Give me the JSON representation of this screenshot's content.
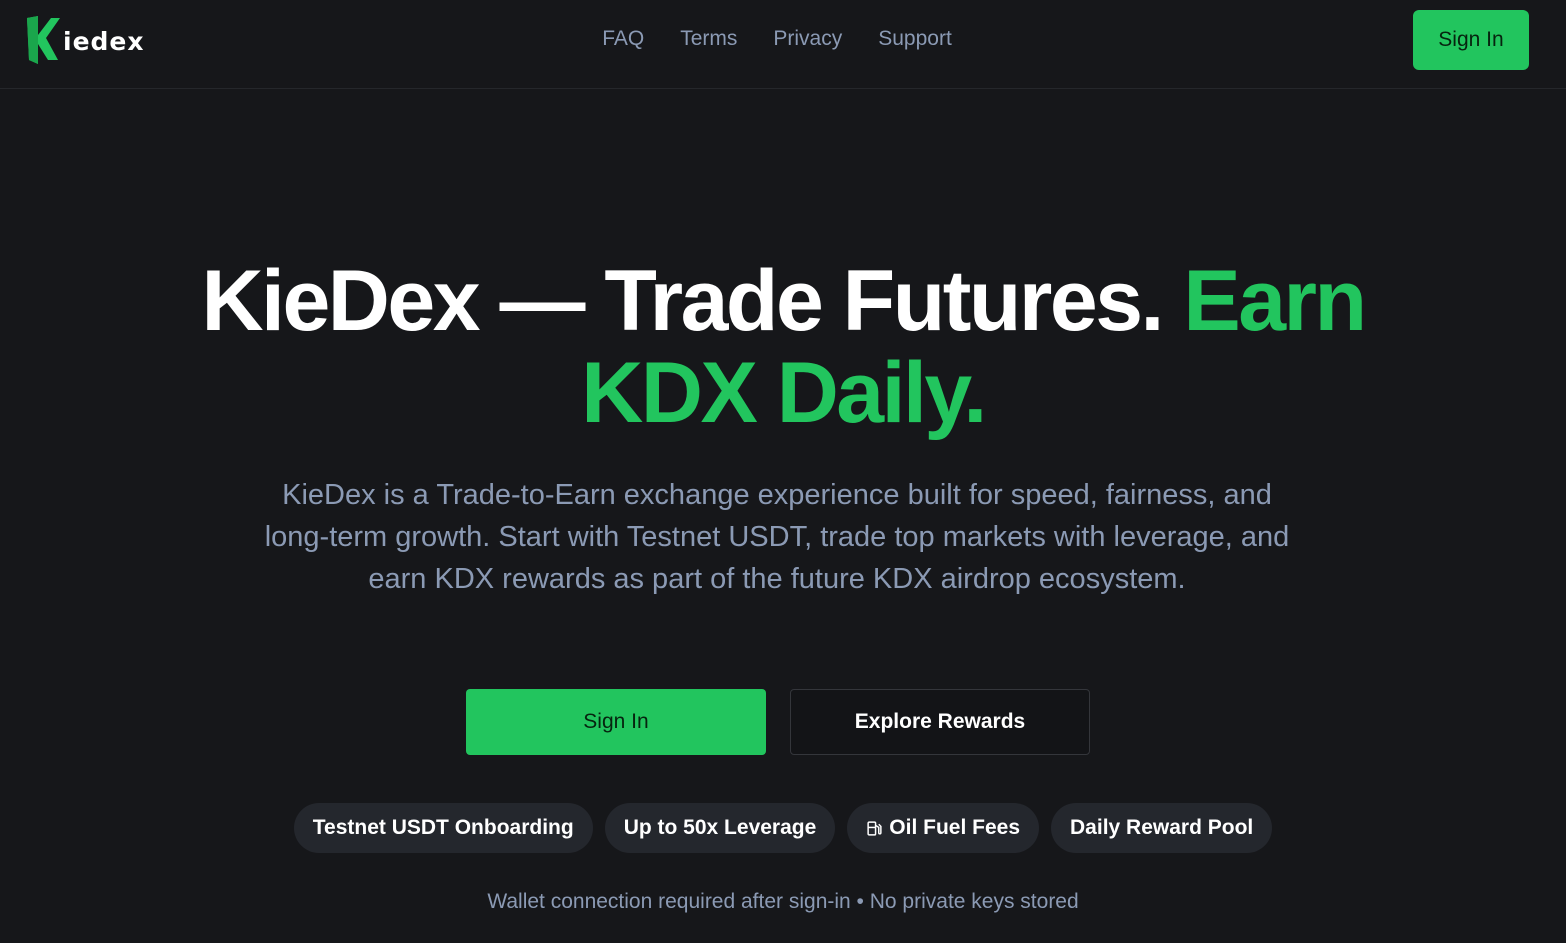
{
  "brand": {
    "logo_text": "iedex",
    "logo_icon": "kiedex-k-logo-icon"
  },
  "nav": {
    "links": [
      "FAQ",
      "Terms",
      "Privacy",
      "Support"
    ],
    "sign_in_label": "Sign In"
  },
  "hero": {
    "title_white": "KieDex — Trade Futures. ",
    "title_green_1": "Earn",
    "title_green_2": "KDX Daily.",
    "description": "KieDex is a Trade-to-Earn exchange experience built for speed, fairness, and long-term growth. Start with Testnet USDT, trade top markets with leverage, and earn KDX rewards as part of the future KDX airdrop ecosystem.",
    "primary_cta": "Sign In",
    "secondary_cta": "Explore Rewards"
  },
  "features": [
    {
      "label": "Testnet USDT Onboarding"
    },
    {
      "label": "Up to 50x Leverage"
    },
    {
      "label": "Oil Fuel Fees",
      "icon": "fuel-pump-icon"
    },
    {
      "label": "Daily Reward Pool"
    }
  ],
  "footnote": "Wallet connection required after sign-in • No private keys stored",
  "colors": {
    "background": "#16171a",
    "accent": "#22c55e",
    "muted_text": "#8b9ab4",
    "pill_bg": "#24272d"
  }
}
